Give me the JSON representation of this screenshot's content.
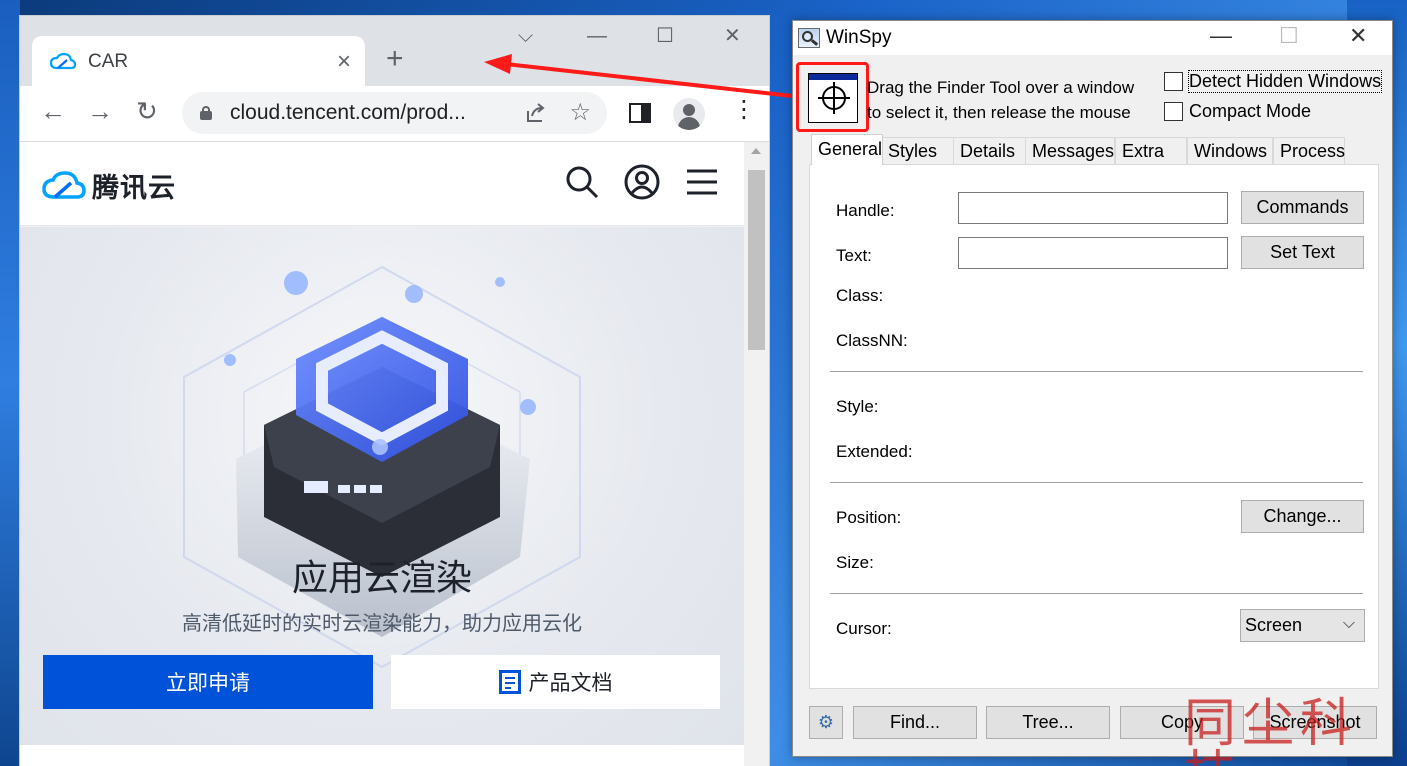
{
  "browser": {
    "tab_title": "CAR",
    "new_tab_glyph": "+",
    "url": "cloud.tencent.com/prod...",
    "window_controls": {
      "dropdown": "⌵",
      "minimize": "—",
      "maximize": "☐",
      "close": "✕"
    },
    "nav": {
      "back": "←",
      "forward": "→",
      "reload": "↻"
    },
    "toolbar_icons": [
      "share-icon",
      "star-icon",
      "sidepanel-icon",
      "profile-icon",
      "menu-icon"
    ]
  },
  "page": {
    "brand": "腾讯云",
    "hero_title": "应用云渲染",
    "hero_subtitle": "高清低延时的实时云渲染能力，助力应用云化",
    "primary_button": "立即申请",
    "secondary_button": "产品文档",
    "colors": {
      "primary": "#0052d9",
      "brand_blue": "#00a4ff"
    }
  },
  "winspy": {
    "title": "WinSpy",
    "finder_text_line1": "Drag the Finder Tool over a window",
    "finder_text_line2": "to select it, then release the mouse",
    "detect_hidden": "Detect Hidden Windows",
    "compact_mode": "Compact Mode",
    "tabs": [
      "General",
      "Styles",
      "Details",
      "Messages",
      "Extra",
      "Windows",
      "Process"
    ],
    "active_tab": "General",
    "labels": {
      "handle": "Handle:",
      "text": "Text:",
      "class": "Class:",
      "classnn": "ClassNN:",
      "style": "Style:",
      "extended": "Extended:",
      "position": "Position:",
      "size": "Size:",
      "cursor": "Cursor:"
    },
    "buttons": {
      "commands": "Commands",
      "set_text": "Set Text",
      "change": "Change...",
      "find": "Find...",
      "tree": "Tree...",
      "copy": "Copy",
      "screenshot": "Screenshot"
    },
    "cursor_combo_value": "Screen",
    "annotation_color": "#ff1a1a"
  },
  "watermark": "同尘科技"
}
